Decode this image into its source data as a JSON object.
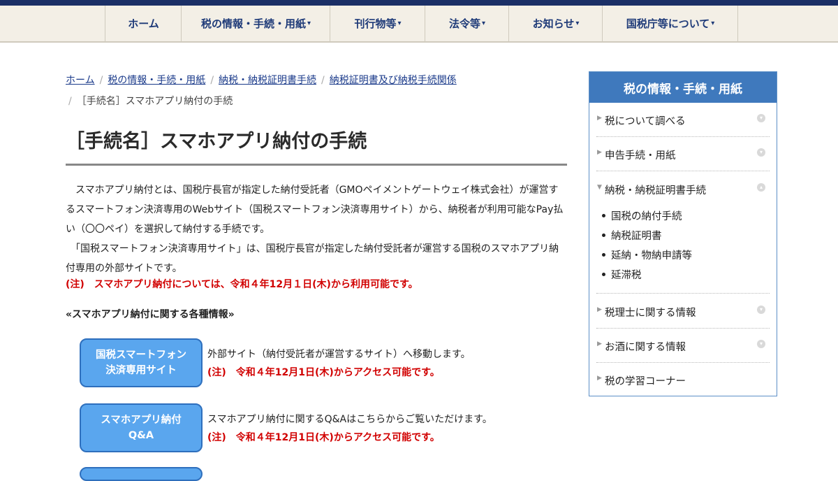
{
  "nav": {
    "items": [
      {
        "label": "ホーム",
        "caret": ""
      },
      {
        "label": "税の情報・手続・用紙",
        "caret": "▾"
      },
      {
        "label": "刊行物等",
        "caret": "▾"
      },
      {
        "label": "法令等",
        "caret": "▾"
      },
      {
        "label": "お知らせ",
        "caret": "▾"
      },
      {
        "label": "国税庁等について",
        "caret": "▾"
      }
    ]
  },
  "breadcrumb": {
    "links": [
      "ホーム",
      "税の情報・手続・用紙",
      "納税・納税証明書手続",
      "納税証明書及び納税手続関係"
    ],
    "separator": "/",
    "current": "［手続名］スマホアプリ納付の手続"
  },
  "main": {
    "title": "［手続名］スマホアプリ納付の手続",
    "intro": [
      "　スマホアプリ納付とは、国税庁長官が指定した納付受託者（GMOペイメントゲートウェイ株式会社）が運営するスマートフォン決済専用のWebサイト（国税スマートフォン決済専用サイト）から、納税者が利用可能なPay払い（〇〇ペイ）を選択して納付する手続です。",
      "　「国税スマートフォン決済専用サイト」は、国税庁長官が指定した納付受託者が運営する国税のスマホアプリ納付専用の外部サイトです。"
    ],
    "note": "(注)　スマホアプリ納付については、令和４年12月１日(木)から利用可能です。",
    "section_heading": "«スマホアプリ納付に関する各種情報»",
    "info": [
      {
        "button_line1": "国税スマートフォン",
        "button_line2": "決済専用サイト",
        "desc": "外部サイト（納付受託者が運営するサイト）へ移動します。",
        "note": "(注)　令和４年12月1日(木)からアクセス可能です。"
      },
      {
        "button_line1": "スマホアプリ納付",
        "button_line2": "Q&A",
        "desc": "スマホアプリ納付に関するQ&Aはこちらからご覧いただけます。",
        "note": "(注)　令和４年12月1日(木)からアクセス可能です。"
      }
    ]
  },
  "sidebar": {
    "heading": "税の情報・手続・用紙",
    "items": [
      "税について調べる",
      "申告手続・用紙",
      "納税・納税証明書手続",
      "税理士に関する情報",
      "お酒に関する情報",
      "税の学習コーナー"
    ],
    "subitems": [
      "国税の納付手続",
      "納税証明書",
      "延納・物納申請等",
      "延滞税"
    ]
  },
  "colors": {
    "nav_text": "#1e3a78",
    "link": "#1a3a8a",
    "note_red": "#d10000",
    "button_fill": "#5aa6ee",
    "sidebar_header": "#3f79bd"
  }
}
